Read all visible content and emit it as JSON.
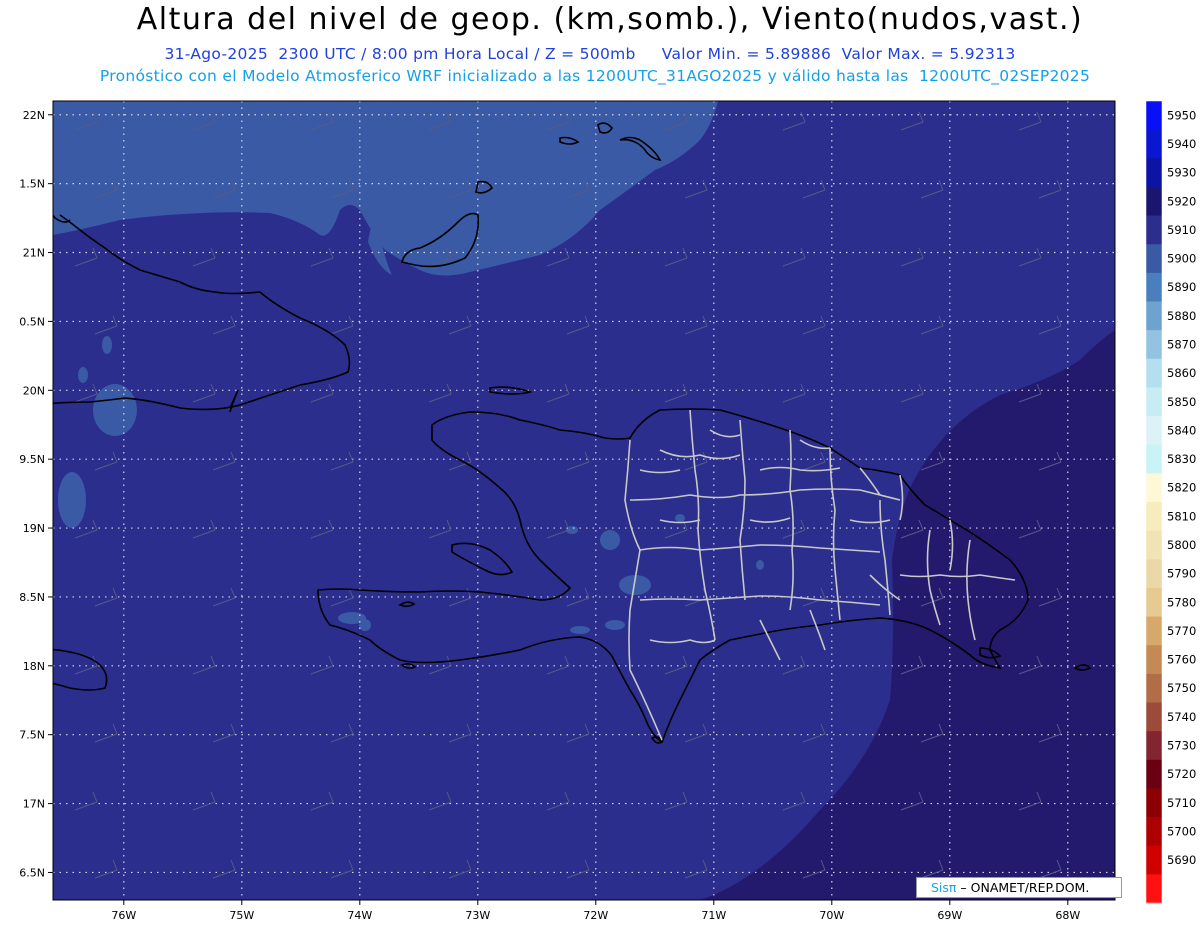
{
  "header": {
    "title": "Altura del nivel de geop. (km,somb.), Viento(nudos,vast.)",
    "line1": "31-Ago-2025  2300 UTC / 8:00 pm Hora Local / Z = 500mb     Valor Min. = 5.89886  Valor Max. = 5.92313",
    "line2": "Pronóstico con el Modelo Atmosferico WRF inicializado a las 1200UTC_31AGO2025 y válido hasta las  1200UTC_02SEP2025"
  },
  "map": {
    "lon_range": [
      -76.6,
      -67.6
    ],
    "lat_range": [
      16.3,
      22.1
    ],
    "lat_ticks": [
      {
        "value": 22.0,
        "label": "22N"
      },
      {
        "value": 21.5,
        "label": "1.5N"
      },
      {
        "value": 21.0,
        "label": "21N"
      },
      {
        "value": 20.5,
        "label": "0.5N"
      },
      {
        "value": 20.0,
        "label": "20N"
      },
      {
        "value": 19.5,
        "label": "9.5N"
      },
      {
        "value": 19.0,
        "label": "19N"
      },
      {
        "value": 18.5,
        "label": "8.5N"
      },
      {
        "value": 18.0,
        "label": "18N"
      },
      {
        "value": 17.5,
        "label": "7.5N"
      },
      {
        "value": 17.0,
        "label": "17N"
      },
      {
        "value": 16.5,
        "label": "6.5N"
      }
    ],
    "lon_ticks": [
      {
        "value": -76,
        "label": "76W"
      },
      {
        "value": -75,
        "label": "75W"
      },
      {
        "value": -74,
        "label": "74W"
      },
      {
        "value": -73,
        "label": "73W"
      },
      {
        "value": -72,
        "label": "72W"
      },
      {
        "value": -71,
        "label": "71W"
      },
      {
        "value": -70,
        "label": "70W"
      },
      {
        "value": -69,
        "label": "69W"
      },
      {
        "value": -68,
        "label": "68W"
      }
    ],
    "colors": {
      "field_5910": "#2b2e8c",
      "field_5900": "#3a5aa6",
      "field_5920": "#231a6e",
      "coast": "#000000",
      "borders": "#c8c8c8",
      "grid": "#d8d8e8"
    }
  },
  "colorbar": {
    "levels": [
      {
        "label": "5950",
        "color": "#0a10f5"
      },
      {
        "label": "5940",
        "color": "#0a16cf"
      },
      {
        "label": "5930",
        "color": "#0c14a6"
      },
      {
        "label": "5920",
        "color": "#1a1670"
      },
      {
        "label": "5910",
        "color": "#2b2e8c"
      },
      {
        "label": "5900",
        "color": "#3a5aa6"
      },
      {
        "label": "5890",
        "color": "#4a7fbe"
      },
      {
        "label": "5880",
        "color": "#6ea2cf"
      },
      {
        "label": "5870",
        "color": "#93c3e0"
      },
      {
        "label": "5860",
        "color": "#b3dfee"
      },
      {
        "label": "5850",
        "color": "#c8ecf4"
      },
      {
        "label": "5840",
        "color": "#dcf2f7"
      },
      {
        "label": "5830",
        "color": "#c9f3f7"
      },
      {
        "label": "5820",
        "color": "#fff8d6"
      },
      {
        "label": "5810",
        "color": "#f7ecbb"
      },
      {
        "label": "5800",
        "color": "#f1e3b3"
      },
      {
        "label": "5790",
        "color": "#ecd8a6"
      },
      {
        "label": "5780",
        "color": "#e6ca92"
      },
      {
        "label": "5770",
        "color": "#d6a86c"
      },
      {
        "label": "5760",
        "color": "#c48a55"
      },
      {
        "label": "5750",
        "color": "#b06d48"
      },
      {
        "label": "5740",
        "color": "#9c4a3a"
      },
      {
        "label": "5730",
        "color": "#822530"
      },
      {
        "label": "5720",
        "color": "#6b0012"
      },
      {
        "label": "5710",
        "color": "#8c0004"
      },
      {
        "label": "5700",
        "color": "#ad0000"
      },
      {
        "label": "5690",
        "color": "#d00000"
      },
      {
        "label": "",
        "color": "#ff1111"
      }
    ]
  },
  "credit": {
    "brand": "Sisπ",
    "text": " – ONAMET/REP.DOM."
  }
}
